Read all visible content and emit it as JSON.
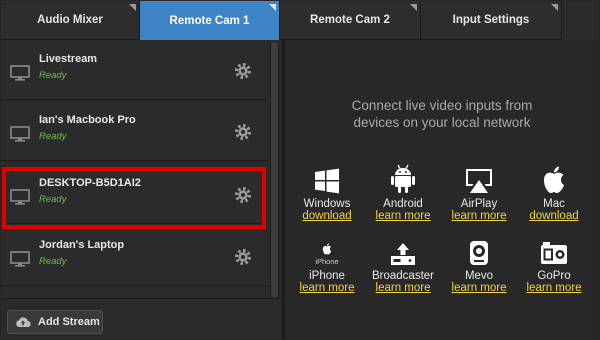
{
  "tabs": [
    {
      "label": "Audio Mixer",
      "active": false
    },
    {
      "label": "Remote Cam 1",
      "active": true
    },
    {
      "label": "Remote Cam 2",
      "active": false
    },
    {
      "label": "Input Settings",
      "active": false
    }
  ],
  "sources": [
    {
      "name": "Livestream",
      "status": "Ready"
    },
    {
      "name": "Ian's Macbook Pro",
      "status": "Ready"
    },
    {
      "name": "DESKTOP-B5D1AI2",
      "status": "Ready",
      "highlighted": true
    },
    {
      "name": "Jordan's Laptop",
      "status": "Ready"
    }
  ],
  "add_stream": {
    "label": "Add Stream",
    "icon": "cloud-upload-icon"
  },
  "connect": {
    "message_line1": "Connect live video inputs from",
    "message_line2": "devices on your local network"
  },
  "platforms": [
    {
      "name": "Windows",
      "link": "download",
      "icon": "windows-icon"
    },
    {
      "name": "Android",
      "link": "learn more",
      "icon": "android-icon"
    },
    {
      "name": "AirPlay",
      "link": "learn more",
      "icon": "airplay-icon"
    },
    {
      "name": "Mac",
      "link": "download",
      "icon": "apple-icon"
    },
    {
      "name": "iPhone",
      "link": "learn more",
      "icon": "iphone-icon",
      "icon_text": "iPhone"
    },
    {
      "name": "Broadcaster",
      "link": "learn more",
      "icon": "broadcaster-icon"
    },
    {
      "name": "Mevo",
      "link": "learn more",
      "icon": "mevo-icon"
    },
    {
      "name": "GoPro",
      "link": "learn more",
      "icon": "gopro-icon"
    }
  ],
  "colors": {
    "active_tab": "#3d85c6",
    "status_ready": "#6dbf4b",
    "link": "#f3d43b",
    "highlight": "#e00000"
  }
}
